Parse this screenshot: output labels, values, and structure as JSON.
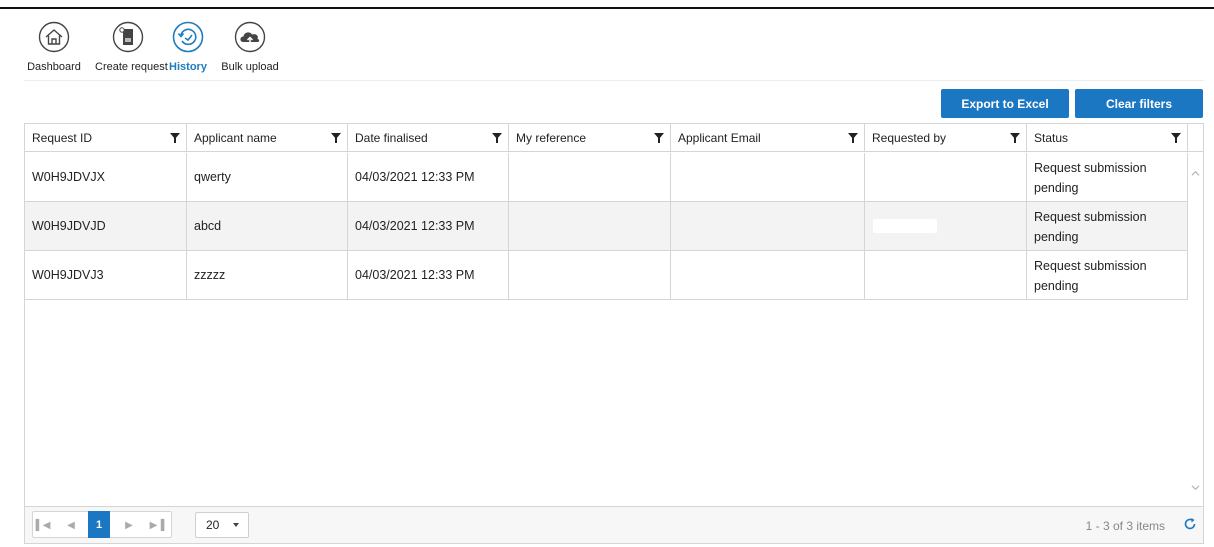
{
  "nav": {
    "items": [
      {
        "label": "Dashboard",
        "icon": "home-icon"
      },
      {
        "label": "Create request",
        "icon": "document-icon"
      },
      {
        "label": "History",
        "icon": "history-icon",
        "active": true
      },
      {
        "label": "Bulk upload",
        "icon": "cloud-upload-icon"
      }
    ]
  },
  "toolbar": {
    "export_label": "Export to Excel",
    "clear_label": "Clear filters"
  },
  "table": {
    "columns": [
      "Request ID",
      "Applicant name",
      "Date finalised",
      "My reference",
      "Applicant Email",
      "Requested by",
      "Status"
    ],
    "rows": [
      {
        "request_id": "W0H9JDVJX",
        "applicant_name": "qwerty",
        "date_finalised": "04/03/2021 12:33 PM",
        "my_reference": "",
        "applicant_email": "",
        "requested_by": "",
        "status": "Request submission pending"
      },
      {
        "request_id": "W0H9JDVJD",
        "applicant_name": "abcd",
        "date_finalised": "04/03/2021 12:33 PM",
        "my_reference": "",
        "applicant_email": "",
        "requested_by": "",
        "status": "Request submission pending"
      },
      {
        "request_id": "W0H9JDVJ3",
        "applicant_name": "zzzzz",
        "date_finalised": "04/03/2021 12:33 PM",
        "my_reference": "",
        "applicant_email": "",
        "requested_by": "",
        "status": "Request submission pending"
      }
    ]
  },
  "pager": {
    "current_page": "1",
    "page_size": "20",
    "info": "1 - 3 of 3 items"
  },
  "colors": {
    "accent": "#1c77c3",
    "active_nav": "#1e7dbf"
  }
}
